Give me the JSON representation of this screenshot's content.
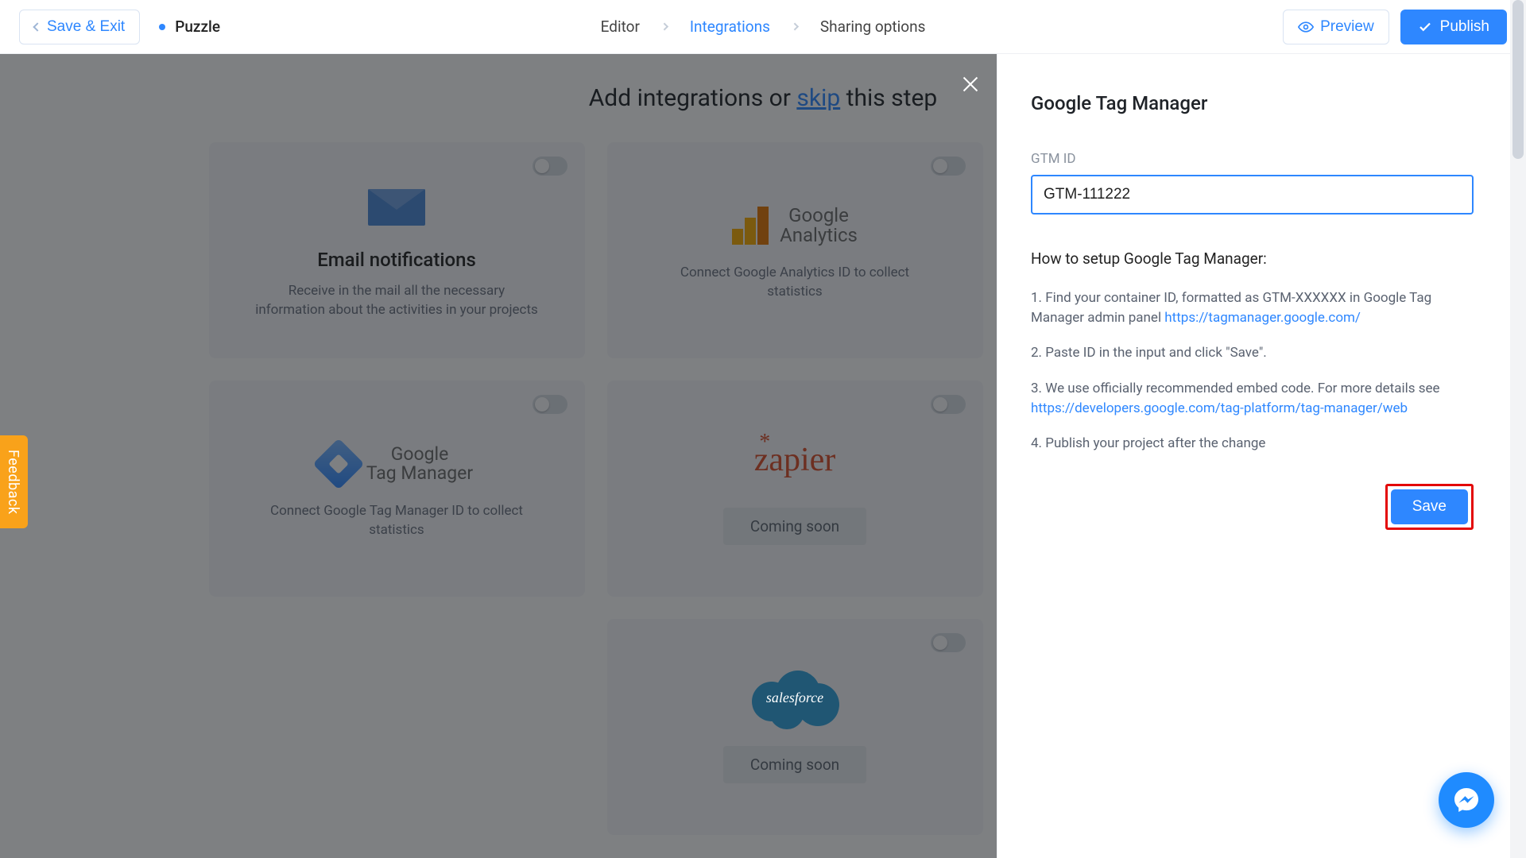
{
  "topbar": {
    "save_exit": "Save & Exit",
    "project_name": "Puzzle",
    "steps": {
      "editor": "Editor",
      "integrations": "Integrations",
      "sharing": "Sharing options"
    },
    "preview": "Preview",
    "publish": "Publish"
  },
  "page": {
    "heading_pre": "Add integrations or ",
    "heading_skip": "skip",
    "heading_post": " this step"
  },
  "cards": {
    "email": {
      "title": "Email notifications",
      "desc": "Receive in the mail all the necessary information about the activities in your projects"
    },
    "ga": {
      "brand_line1": "Google",
      "brand_line2": "Analytics",
      "desc": "Connect Google Analytics ID to collect statistics"
    },
    "gtm": {
      "brand_line1": "Google",
      "brand_line2": "Tag Manager",
      "desc": "Connect Google Tag Manager ID to collect statistics"
    },
    "zapier": {
      "brand": "zapier",
      "coming": "Coming soon"
    },
    "salesforce": {
      "brand": "salesforce",
      "coming": "Coming soon"
    }
  },
  "panel": {
    "title": "Google Tag Manager",
    "field_label": "GTM ID",
    "field_value": "GTM-111222",
    "howto_title": "How to setup Google Tag Manager:",
    "step1_pre": "1. Find your container ID, formatted as GTM-XXXXXX in Google Tag Manager admin panel ",
    "step1_link": "https://tagmanager.google.com/",
    "step2": "2. Paste ID in the input and click \"Save\".",
    "step3_pre": "3. We use officially recommended embed code. For more details see ",
    "step3_link": "https://developers.google.com/tag-platform/tag-manager/web",
    "step4": "4. Publish your project after the change",
    "save": "Save"
  },
  "feedback_label": "Feedback"
}
